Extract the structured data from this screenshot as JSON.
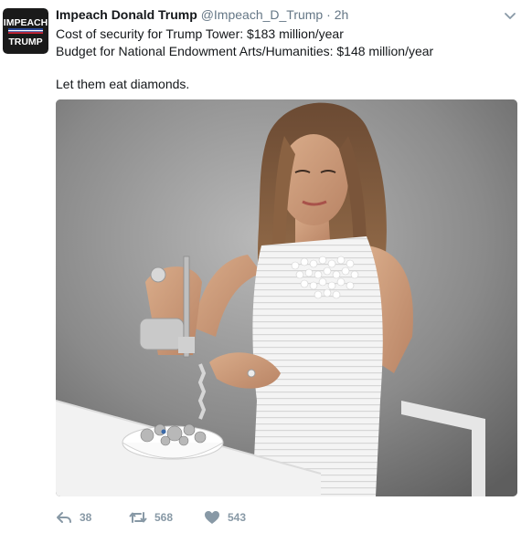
{
  "tweet": {
    "author_name": "Impeach Donald Trump",
    "author_handle": "@Impeach_D_Trump",
    "separator": "·",
    "time": "2h",
    "avatar_text": {
      "line1": "IMPEACH",
      "line2": "TRUMP"
    },
    "text_lines": [
      "Cost of security for Trump Tower: $183 million/year",
      "Budget for National Endowment Arts/Humanities: $148 million/year",
      "Let them eat diamonds."
    ],
    "media_icon": "photo-woman-eating-jewelry",
    "actions": {
      "reply_icon": "reply-icon",
      "reply_count": "38",
      "retweet_icon": "retweet-icon",
      "retweet_count": "568",
      "like_icon": "heart-icon",
      "like_count": "543"
    }
  },
  "colors": {
    "text": "#14171a",
    "secondary": "#657786",
    "action": "#8899a6",
    "avatar_bg": "#1a1a1a",
    "avatar_flag_blue": "#2b4a9a",
    "avatar_flag_red": "#c8202b"
  }
}
